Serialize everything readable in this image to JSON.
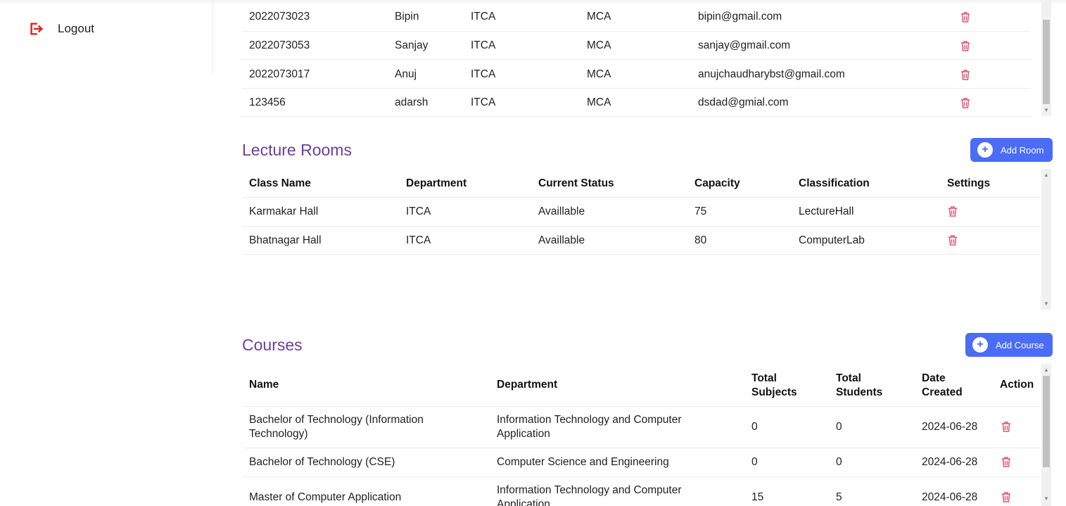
{
  "sidebar": {
    "logout_label": "Logout"
  },
  "students": {
    "rows": [
      [
        "2022073023",
        "Bipin",
        "ITCA",
        "MCA",
        "bipin@gmail.com"
      ],
      [
        "2022073053",
        "Sanjay",
        "ITCA",
        "MCA",
        "sanjay@gmail.com"
      ],
      [
        "2022073017",
        "Anuj",
        "ITCA",
        "MCA",
        "anujchaudharybst@gmail.com"
      ],
      [
        "123456",
        "adarsh",
        "ITCA",
        "MCA",
        "dsdad@gmial.com"
      ]
    ]
  },
  "rooms": {
    "title": "Lecture Rooms",
    "add_label": "Add Room",
    "headers": [
      "Class Name",
      "Department",
      "Current Status",
      "Capacity",
      "Classification",
      "Settings"
    ],
    "rows": [
      [
        "Karmakar Hall",
        "ITCA",
        "Availlable",
        "75",
        "LectureHall"
      ],
      [
        "Bhatnagar Hall",
        "ITCA",
        "Availlable",
        "80",
        "ComputerLab"
      ]
    ]
  },
  "courses": {
    "title": "Courses",
    "add_label": "Add Course",
    "headers": {
      "name": "Name",
      "department": "Department",
      "subjects_1": "Total",
      "subjects_2": "Subjects",
      "students_1": "Total",
      "students_2": "Students",
      "date_1": "Date",
      "date_2": "Created",
      "action": "Action"
    },
    "rows": [
      {
        "name_1": "Bachelor of Technology (Information",
        "name_2": "Technology)",
        "dept_1": "Information Technology and Computer",
        "dept_2": "Application",
        "subjects": "0",
        "students": "0",
        "date": "2024-06-28"
      },
      {
        "name_1": "Bachelor of Technology (CSE)",
        "name_2": "",
        "dept_1": "Computer Science and Engineering",
        "dept_2": "",
        "subjects": "0",
        "students": "0",
        "date": "2024-06-28"
      },
      {
        "name_1": "Master of Computer Application",
        "name_2": "",
        "dept_1": "Information Technology and Computer",
        "dept_2": "Application",
        "subjects": "15",
        "students": "5",
        "date": "2024-06-28"
      }
    ]
  },
  "colors": {
    "title": "#6b3fa0",
    "button": "#4a6cf7",
    "delete": "#e0526b",
    "logout": "#e02020"
  },
  "icons": {
    "logout": "logout-icon",
    "add": "plus-circle-icon",
    "delete": "trash-icon"
  }
}
